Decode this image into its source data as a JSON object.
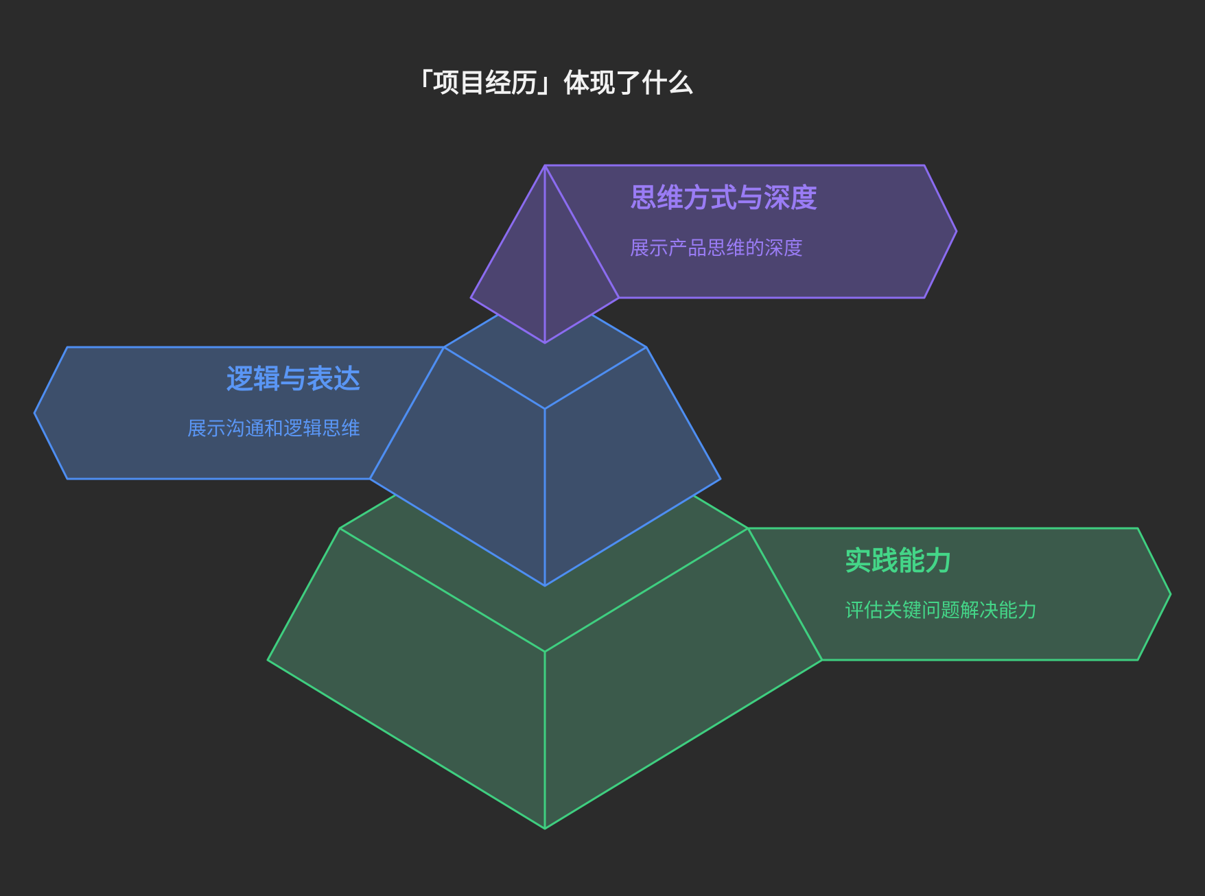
{
  "diagram": {
    "title": "「项目经历」体现了什么",
    "tiers": [
      {
        "id": "top",
        "title": "思维方式与深度",
        "description": "展示产品思维的深度",
        "stroke": "#8b6cf0",
        "fill": "#4c4470",
        "text_color": "#9a7cf5"
      },
      {
        "id": "middle",
        "title": "逻辑与表达",
        "description": "展示沟通和逻辑思维",
        "stroke": "#4e8ef2",
        "fill": "#3d4f6b",
        "text_color": "#5a96f5"
      },
      {
        "id": "bottom",
        "title": "实践能力",
        "description": "评估关键问题解决能力",
        "stroke": "#3fcf80",
        "fill": "#3b5a4b",
        "text_color": "#44d688"
      }
    ]
  }
}
